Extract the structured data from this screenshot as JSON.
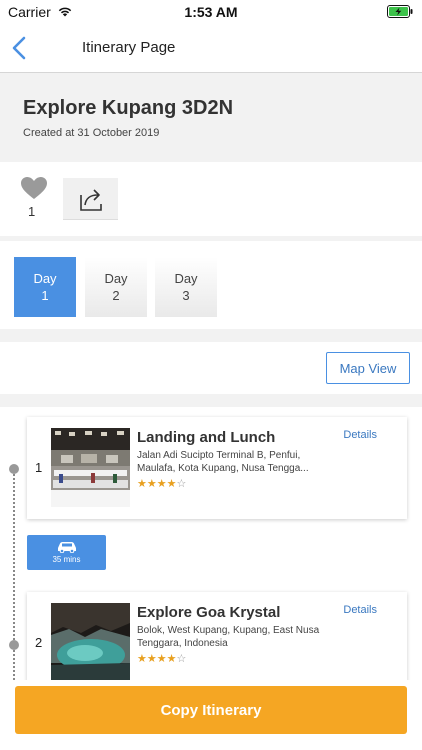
{
  "status_bar": {
    "carrier": "Carrier",
    "time": "1:53 AM"
  },
  "nav": {
    "title": "Itinerary Page"
  },
  "trip": {
    "title": "Explore Kupang 3D2N",
    "created": "Created at 31 October 2019"
  },
  "actions": {
    "like_count": "1"
  },
  "days": [
    {
      "label": "Day",
      "number": "1",
      "active": true
    },
    {
      "label": "Day",
      "number": "2",
      "active": false
    },
    {
      "label": "Day",
      "number": "3",
      "active": false
    }
  ],
  "map_view_label": "Map View",
  "stops": [
    {
      "number": "1",
      "name": "Landing and Lunch",
      "address": "Jalan Adi Sucipto Terminal B, Penfui, Maulafa, Kota Kupang, Nusa Tengga...",
      "rating": 4,
      "details_label": "Details"
    },
    {
      "number": "2",
      "name": "Explore Goa Krystal",
      "address": "Bolok, West Kupang, Kupang, East Nusa Tenggara, Indonesia",
      "rating": 4,
      "details_label": "Details"
    }
  ],
  "transit": {
    "duration": "35 mins"
  },
  "copy_button_label": "Copy Itinerary",
  "colors": {
    "accent_blue": "#4a90e2",
    "copy_orange": "#f5a623",
    "star": "#e8a020"
  }
}
